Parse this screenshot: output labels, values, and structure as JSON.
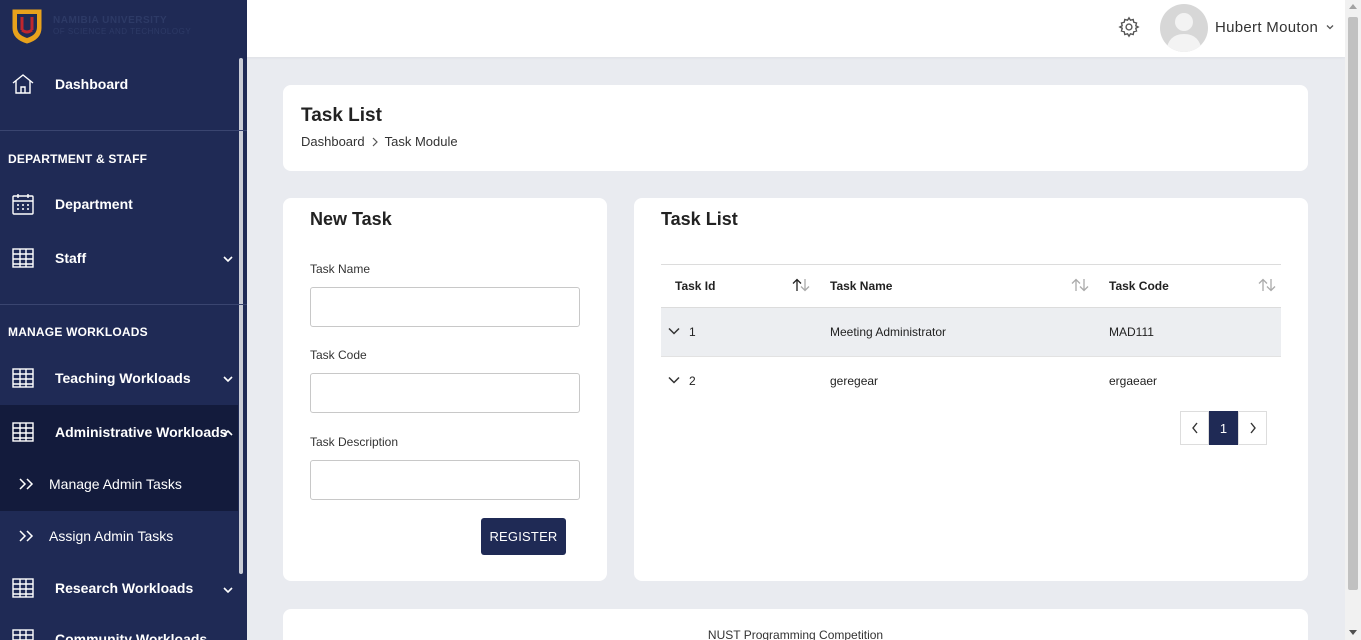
{
  "sidebar": {
    "logo_text_line1": "NAMIBIA UNIVERSITY",
    "logo_text_line2": "OF SCIENCE AND TECHNOLOGY",
    "dashboard": "Dashboard",
    "section_dept": "DEPARTMENT & STAFF",
    "department": "Department",
    "staff": "Staff",
    "section_workloads": "MANAGE WORKLOADS",
    "teaching": "Teaching Workloads",
    "administrative": "Administrative Workloads",
    "manage_admin_tasks": "Manage Admin Tasks",
    "assign_admin_tasks": "Assign Admin Tasks",
    "research": "Research Workloads",
    "community": "Community Workloads"
  },
  "topbar": {
    "user_name": "Hubert Mouton"
  },
  "header": {
    "title": "Task List",
    "breadcrumb": [
      "Dashboard",
      "Task Module"
    ]
  },
  "form": {
    "title": "New Task",
    "task_name_label": "Task Name",
    "task_name_value": "",
    "task_code_label": "Task Code",
    "task_code_value": "",
    "task_description_label": "Task Description",
    "task_description_value": "",
    "register_label": "REGISTER"
  },
  "task_list": {
    "title": "Task List",
    "columns": [
      "Task Id",
      "Task Name",
      "Task Code"
    ],
    "rows": [
      {
        "id": "1",
        "name": "Meeting Administrator",
        "code": "MAD111"
      },
      {
        "id": "2",
        "name": "geregear",
        "code": "ergaeaer"
      }
    ],
    "current_page": "1"
  },
  "footer": {
    "text": "NUST Programming Competition"
  },
  "colors": {
    "sidebar_bg": "#1f2a55",
    "sidebar_active": "#131b3c",
    "accent": "#1f2a55",
    "page_bg": "#e9ebf0"
  }
}
